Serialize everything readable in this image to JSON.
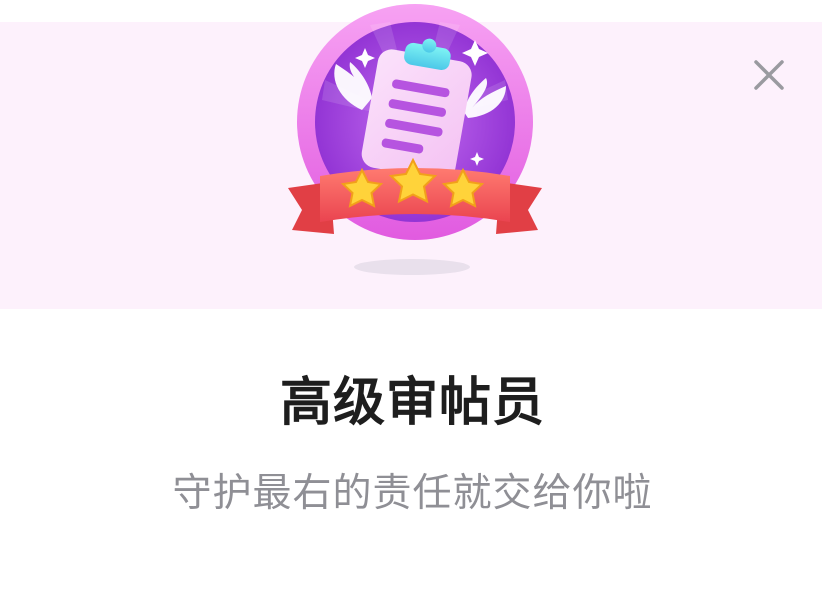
{
  "dialog": {
    "title": "高级审帖员",
    "description": "守护最右的责任就交给你啦"
  },
  "badge": {
    "icon": "clipboard-badge-icon",
    "stars": 3
  },
  "close": {
    "icon": "close-icon"
  },
  "colors": {
    "banner_bg": "#fdf1fc",
    "badge_ring": "#f07ae8",
    "badge_inner": "#9b3ad8",
    "ribbon": "#f45a5a",
    "star": "#ffd33a",
    "title": "#1e1e1e",
    "subtitle": "#8f8f95",
    "close_icon": "#9a9aa0"
  }
}
